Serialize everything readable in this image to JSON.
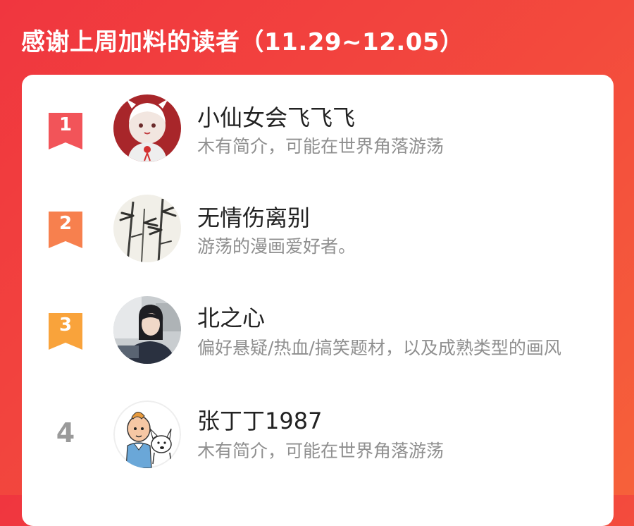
{
  "header": {
    "title": "感谢上周加料的读者（11.29~12.05）"
  },
  "colors": {
    "background_start": "#f0363f",
    "background_end": "#f6613a",
    "rank1": "#f25459",
    "rank2": "#f7804e",
    "rank3": "#f9a33b",
    "rank_plain": "#9a9a9a"
  },
  "readers": [
    {
      "rank": "1",
      "name": "小仙女会飞飞飞",
      "bio": "木有简介，可能在世界角落游荡",
      "avatar_icon": "anime-girl-avatar"
    },
    {
      "rank": "2",
      "name": "无情伤离别",
      "bio": "游荡的漫画爱好者。",
      "avatar_icon": "bamboo-painting-avatar"
    },
    {
      "rank": "3",
      "name": "北之心",
      "bio": "偏好悬疑/热血/搞笑题材，以及成熟类型的画风",
      "avatar_icon": "person-photo-avatar"
    },
    {
      "rank": "4",
      "name": "张丁丁1987",
      "bio": "木有简介，可能在世界角落游荡",
      "avatar_icon": "tintin-avatar"
    }
  ]
}
